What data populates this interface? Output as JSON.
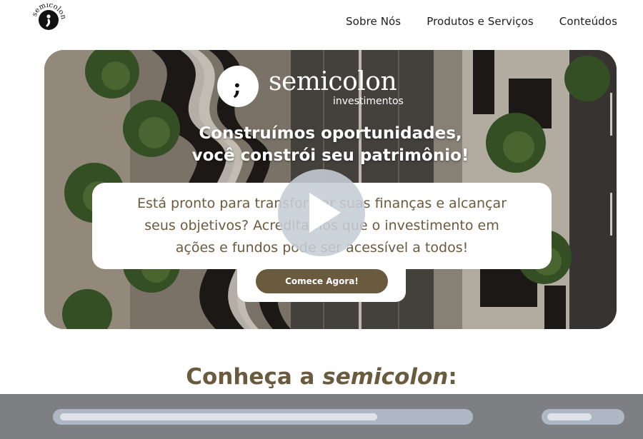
{
  "header": {
    "logo_text": "semicolon",
    "nav": [
      {
        "label": "Sobre Nós"
      },
      {
        "label": "Produtos e Serviços"
      },
      {
        "label": "Conteúdos"
      }
    ]
  },
  "hero": {
    "brand_mark": ";",
    "brand_name": "semicolon",
    "brand_sub": "investimentos",
    "headline_line1": "Construímos oportunidades,",
    "headline_line2": "você constrói seu patrimônio!",
    "body_line1": "Está pronto para transformar suas finanças e alcançar",
    "body_line2": "seus objetivos? Acreditamos que o investimento em",
    "body_line3": "ações e fundos pode ser acessível a todos!",
    "cta_label": "Comece Agora!"
  },
  "video": {
    "play_icon": "play-icon"
  },
  "section": {
    "title_prefix": "Conheça a ",
    "title_brand": "semicolon",
    "title_suffix": ":"
  },
  "colors": {
    "brand_brown": "#6b5b3e",
    "text_brown": "#6b5a3e",
    "overlay_gray": "#7d7f82",
    "play_gray": "#c6cdd6"
  }
}
